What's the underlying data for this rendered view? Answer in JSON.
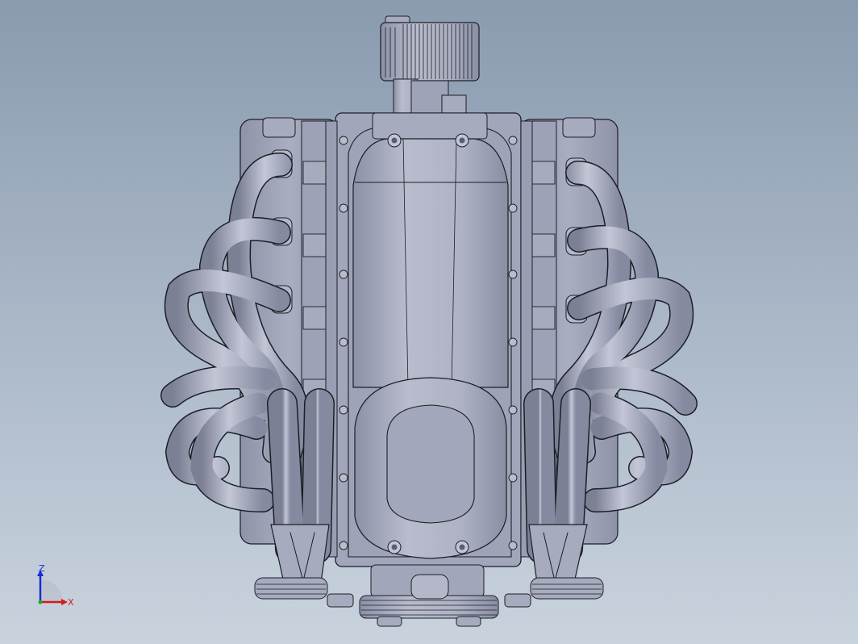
{
  "viewport": {
    "background_top": "#8a9bb0",
    "background_bottom": "#c9d3de"
  },
  "model": {
    "part_color": "#a7abbe",
    "edge_color": "#1c1e26",
    "shade_color": "#7f8397",
    "highlight_color": "#c6c9d8"
  },
  "triad": {
    "z_label": "Z",
    "x_label": "X",
    "z_color": "#1a2bd6",
    "x_color": "#d61a1a"
  }
}
